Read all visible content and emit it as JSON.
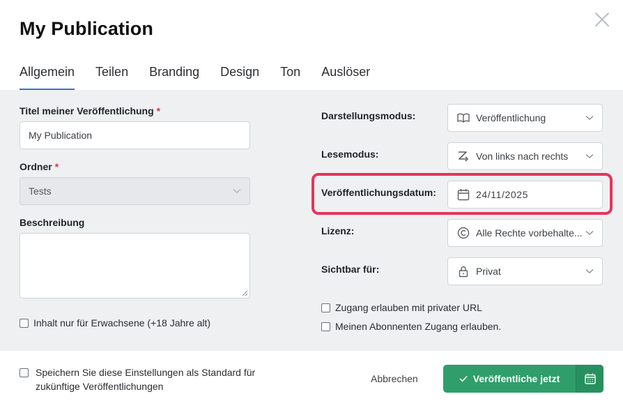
{
  "dialog": {
    "title": "My Publication"
  },
  "tabs": [
    {
      "label": "Allgemein",
      "active": true
    },
    {
      "label": "Teilen"
    },
    {
      "label": "Branding"
    },
    {
      "label": "Design"
    },
    {
      "label": "Ton"
    },
    {
      "label": "Auslöser"
    }
  ],
  "left": {
    "title_label": "Titel meiner Veröffentlichung",
    "title_value": "My Publication",
    "folder_label": "Ordner",
    "folder_value": "Tests",
    "description_label": "Beschreibung",
    "description_value": "",
    "adult_label": "Inhalt nur für Erwachsene (+18 Jahre alt)",
    "required_mark": "*"
  },
  "right": {
    "display_mode_label": "Darstellungsmodus:",
    "display_mode_value": "Veröffentlichung",
    "reading_mode_label": "Lesemodus:",
    "reading_mode_value": "Von links nach rechts",
    "date_label": "Veröffentlichungsdatum:",
    "date_value": "24/11/2025",
    "license_label": "Lizenz:",
    "license_value": "Alle Rechte vorbehalte...",
    "visible_label": "Sichtbar für:",
    "visible_value": "Privat",
    "private_url_label": "Zugang erlauben mit privater URL",
    "subscribers_label": "Meinen Abonnenten Zugang erlauben."
  },
  "footer": {
    "save_default_line1": "Speichern Sie diese Einstellungen als Standard für",
    "save_default_line2": "zukünftige Veröffentlichungen",
    "cancel_label": "Abbrechen",
    "publish_label": "Veröffentliche jetzt"
  },
  "colors": {
    "accent_tab": "#3a72c4",
    "highlight": "#e5355a",
    "publish": "#2f9e6a",
    "required": "#e0314b"
  },
  "icons": {
    "close": "close-icon",
    "display_mode": "book-icon",
    "reading_mode": "ltr-direction-icon",
    "date": "calendar-icon",
    "license": "copyright-icon",
    "visible": "lock-icon",
    "publish_check": "check-icon",
    "schedule": "calendar-icon"
  }
}
